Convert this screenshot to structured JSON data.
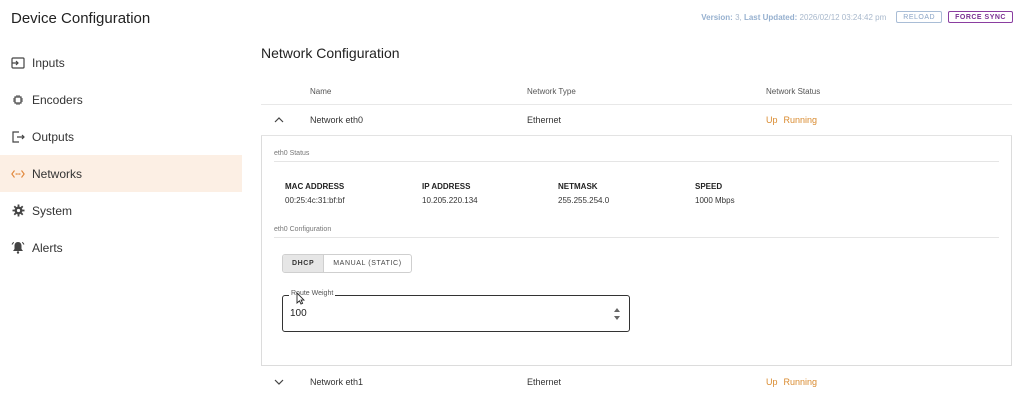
{
  "app": {
    "title": "Device Configuration"
  },
  "sidebar": {
    "items": [
      {
        "label": "Inputs",
        "icon": "input-icon"
      },
      {
        "label": "Encoders",
        "icon": "chip-icon"
      },
      {
        "label": "Outputs",
        "icon": "output-icon"
      },
      {
        "label": "Networks",
        "icon": "network-icon",
        "active": true
      },
      {
        "label": "System",
        "icon": "gear-icon"
      },
      {
        "label": "Alerts",
        "icon": "bell-icon"
      }
    ]
  },
  "topbar": {
    "version_label": "Version:",
    "version_value": "3",
    "updated_label": "Last Updated:",
    "updated_value": "2026/02/12 03:24:42 pm",
    "reload_label": "RELOAD",
    "force_sync_label": "FORCE SYNC"
  },
  "main": {
    "title": "Network Configuration",
    "columns": {
      "name": "Name",
      "type": "Network Type",
      "status": "Network Status"
    },
    "networks": [
      {
        "name": "Network eth0",
        "type": "Ethernet",
        "status_up": "Up",
        "status_run": "Running",
        "expanded": true,
        "status_section": "eth0 Status",
        "mac_label": "MAC ADDRESS",
        "mac_value": "00:25:4c:31:bf:bf",
        "ip_label": "IP ADDRESS",
        "ip_value": "10.205.220.134",
        "netmask_label": "NETMASK",
        "netmask_value": "255.255.254.0",
        "speed_label": "SPEED",
        "speed_value": "1000 Mbps",
        "config_section": "eth0 Configuration",
        "mode_options": [
          "DHCP",
          "MANUAL (STATIC)"
        ],
        "mode_selected": "DHCP",
        "route_weight_label": "Route Weight",
        "route_weight_value": "100"
      },
      {
        "name": "Network eth1",
        "type": "Ethernet",
        "status_up": "Up",
        "status_run": "Running",
        "expanded": false
      }
    ]
  },
  "colors": {
    "accent": "#e1873a",
    "active_bg": "#fcefe4",
    "status": "#d98a2e",
    "force_sync": "#7a2f92",
    "reload": "#8aa4c6"
  }
}
